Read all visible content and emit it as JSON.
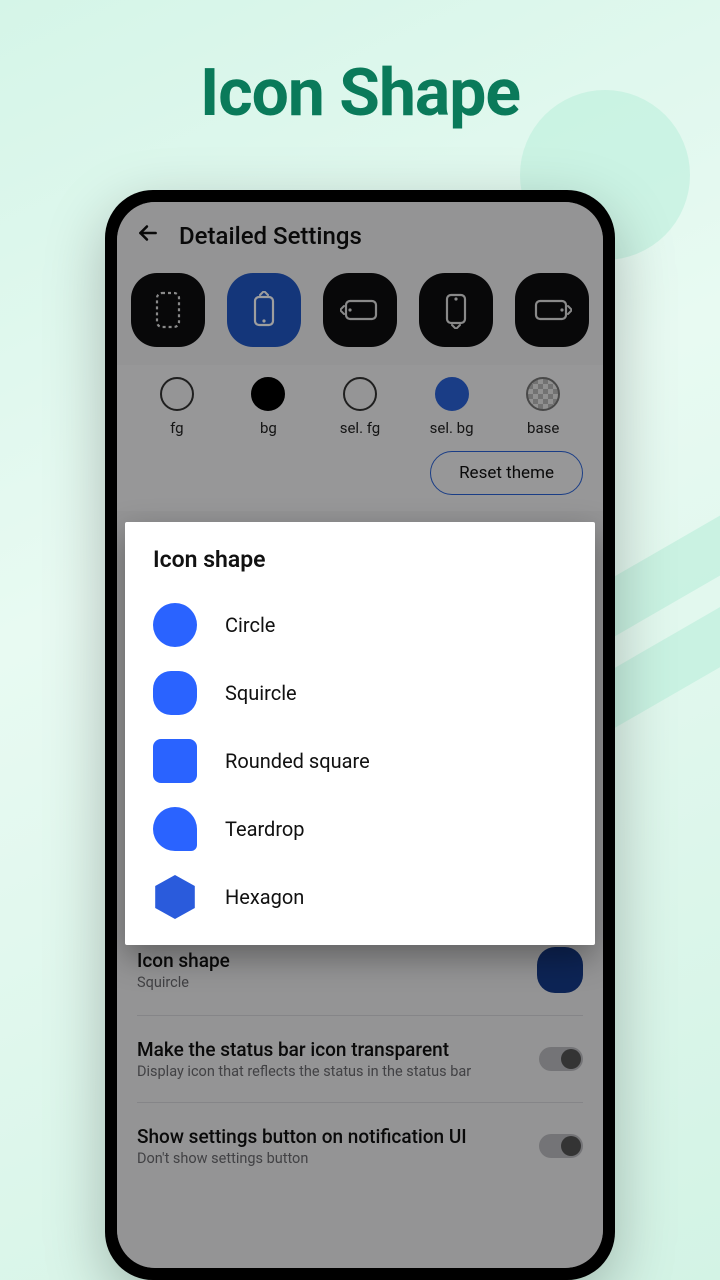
{
  "hero": {
    "title": "Icon Shape"
  },
  "header": {
    "title": "Detailed Settings"
  },
  "colors": [
    {
      "label": "fg"
    },
    {
      "label": "bg"
    },
    {
      "label": "sel. fg"
    },
    {
      "label": "sel. bg"
    },
    {
      "label": "base"
    }
  ],
  "reset": {
    "label": "Reset theme"
  },
  "dialog": {
    "title": "Icon shape",
    "options": [
      {
        "label": "Circle"
      },
      {
        "label": "Squircle"
      },
      {
        "label": "Rounded square"
      },
      {
        "label": "Teardrop"
      },
      {
        "label": "Hexagon"
      }
    ]
  },
  "settings": {
    "icon_shape": {
      "title": "Icon shape",
      "sub": "Squircle"
    },
    "status_bar": {
      "title": "Make the status bar icon transparent",
      "sub": "Display icon that reflects the status in the status bar"
    },
    "show_btn": {
      "title": "Show settings button on notification UI",
      "sub": "Don't show settings button"
    }
  }
}
